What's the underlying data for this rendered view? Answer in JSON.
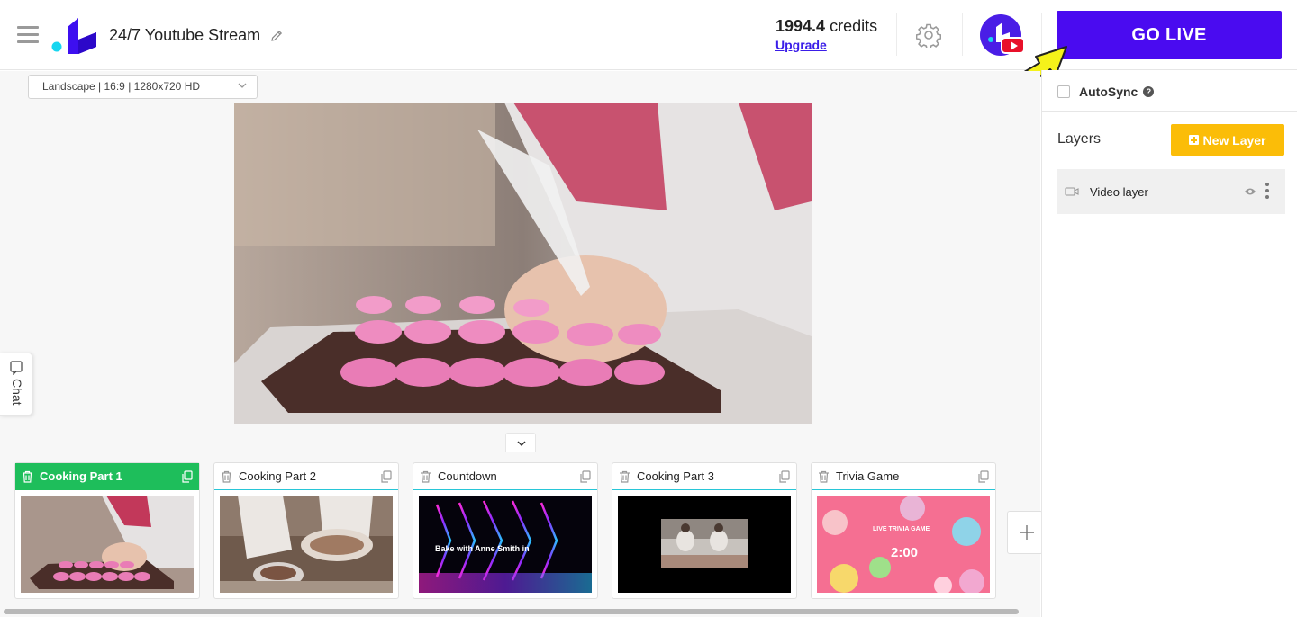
{
  "header": {
    "title": "24/7 Youtube Stream",
    "credits_value": "1994.4",
    "credits_unit": "credits",
    "upgrade_label": "Upgrade",
    "go_live_label": "GO LIVE"
  },
  "canvas": {
    "resolution_value": "Landscape | 16:9 | 1280x720 HD",
    "chat_label": "Chat"
  },
  "right_panel": {
    "autosync_label": "AutoSync",
    "help_glyph": "?",
    "layers_title": "Layers",
    "new_layer_label": "New Layer",
    "layers": [
      {
        "label": "Video layer"
      }
    ]
  },
  "scenes": [
    {
      "name": "Cooking Part 1",
      "active": true
    },
    {
      "name": "Cooking Part 2",
      "active": false
    },
    {
      "name": "Countdown",
      "active": false,
      "thumb_text": "Bake with Anne Smith in"
    },
    {
      "name": "Cooking Part 3",
      "active": false
    },
    {
      "name": "Trivia Game",
      "active": false,
      "thumb_title": "LIVE TRIVIA GAME",
      "thumb_timer": "2:00"
    }
  ],
  "colors": {
    "go_live": "#4a0bf0",
    "new_layer": "#fbbd08",
    "active_scene": "#1ebe5b",
    "scene_underline": "#27c6d7",
    "youtube_red": "#e8102a",
    "annotation_arrow": "#f5f21a"
  },
  "icons": [
    "hamburger-icon",
    "logo-icon",
    "pencil-icon",
    "gear-icon",
    "youtube-icon",
    "arrow-icon",
    "help-icon",
    "plus-icon",
    "camera-icon",
    "eye-icon",
    "kebab-icon",
    "chevron-down-icon",
    "chat-icon",
    "trash-icon",
    "copy-icon"
  ]
}
